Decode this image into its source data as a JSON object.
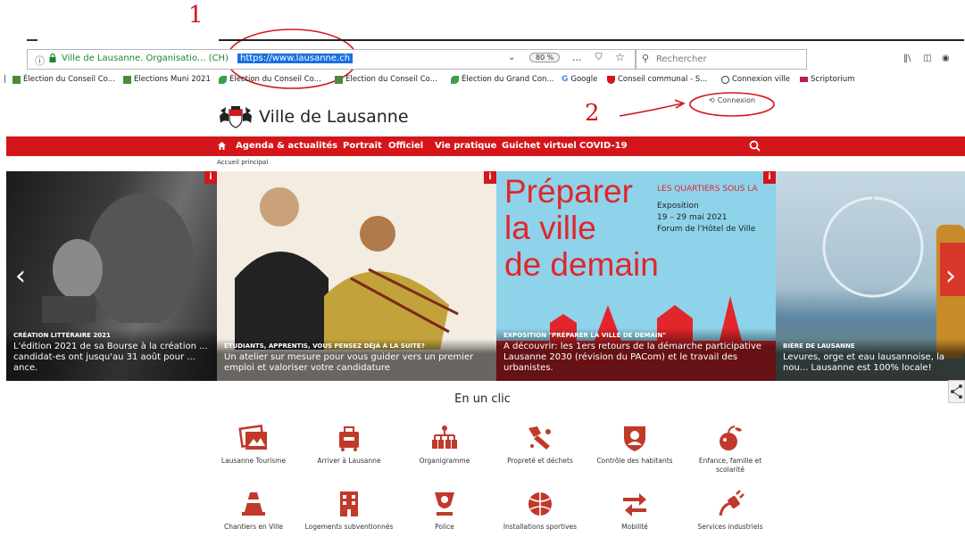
{
  "annotations": {
    "num1": "1",
    "num2": "2"
  },
  "browser": {
    "site_identity": "Ville de Lausanne. Organisatio... (CH)",
    "url": "https://www.lausanne.ch",
    "zoom": "80 %",
    "more_icon": "...",
    "search_placeholder": "Rechercher"
  },
  "bookmarks": [
    {
      "label": "Élection du Conseil Co...",
      "icon": "doc-icon"
    },
    {
      "label": "Elections Muni 2021",
      "icon": "doc-icon"
    },
    {
      "label": "Élection du Conseil Co...",
      "icon": "leaf-icon"
    },
    {
      "label": "Élection du Conseil Co...",
      "icon": "doc-icon"
    },
    {
      "label": "Élection du Grand Con...",
      "icon": "leaf-icon"
    },
    {
      "label": "Google",
      "icon": "google-icon"
    },
    {
      "label": "Conseil communal - S...",
      "icon": "shield-icon"
    },
    {
      "label": "Connexion ville",
      "icon": "globe-icon"
    },
    {
      "label": "Scriptorium",
      "icon": "flag-icon"
    }
  ],
  "site": {
    "title": "Ville de Lausanne",
    "connexion": "Connexion",
    "breadcrumb": "Accueil principal",
    "accent": "#d4161b"
  },
  "nav": {
    "items": [
      "Agenda & actualités",
      "Portrait",
      "Officiel",
      "Vie pratique",
      "Guichet virtuel",
      "COVID-19"
    ]
  },
  "slides": [
    {
      "kicker": "CRÉATION LITTÉRAIRE 2021",
      "text": "L'édition 2021 de sa Bourse à la création ... candidat-es ont jusqu'au 31 août pour ... ance."
    },
    {
      "kicker": "ÉTUDIANTS, APPRENTIS, VOUS PENSEZ DÉJÀ À LA SUITE?",
      "text": "Un atelier sur mesure pour vous guider vers un premier emploi et valoriser votre candidature"
    },
    {
      "kicker": "EXPOSITION \"PRÉPARER LA VILLE DE DEMAIN\"",
      "text": "A découvrir: les 1ers retours de la démarche participative Lausanne 2030 (révision du PACom) et le travail des urbanistes.",
      "poster_big": [
        "Préparer",
        "la ville",
        "de demain"
      ],
      "poster_side": [
        "LES QUARTIERS SOUS LA",
        "Exposition",
        "19 – 29 mai 2021",
        "Forum de l'Hôtel de Ville"
      ]
    },
    {
      "kicker": "BIÈRE DE LAUSANNE",
      "text": "Levures, orge et eau lausannoise, la nou... Lausanne est 100% locale!"
    }
  ],
  "section": {
    "title": "En un clic"
  },
  "clic_row1": [
    {
      "label": "Lausanne Tourisme"
    },
    {
      "label": "Arriver à Lausanne"
    },
    {
      "label": "Organigramme"
    },
    {
      "label": "Propreté et déchets"
    },
    {
      "label": "Contrôle des habitants"
    },
    {
      "label": "Enfance, famille et scolarité"
    }
  ],
  "clic_row2": [
    {
      "label": "Chantiers en Ville"
    },
    {
      "label": "Logements subventionnés"
    },
    {
      "label": "Police"
    },
    {
      "label": "Installations sportives"
    },
    {
      "label": "Mobilité"
    },
    {
      "label": "Services industriels"
    }
  ]
}
